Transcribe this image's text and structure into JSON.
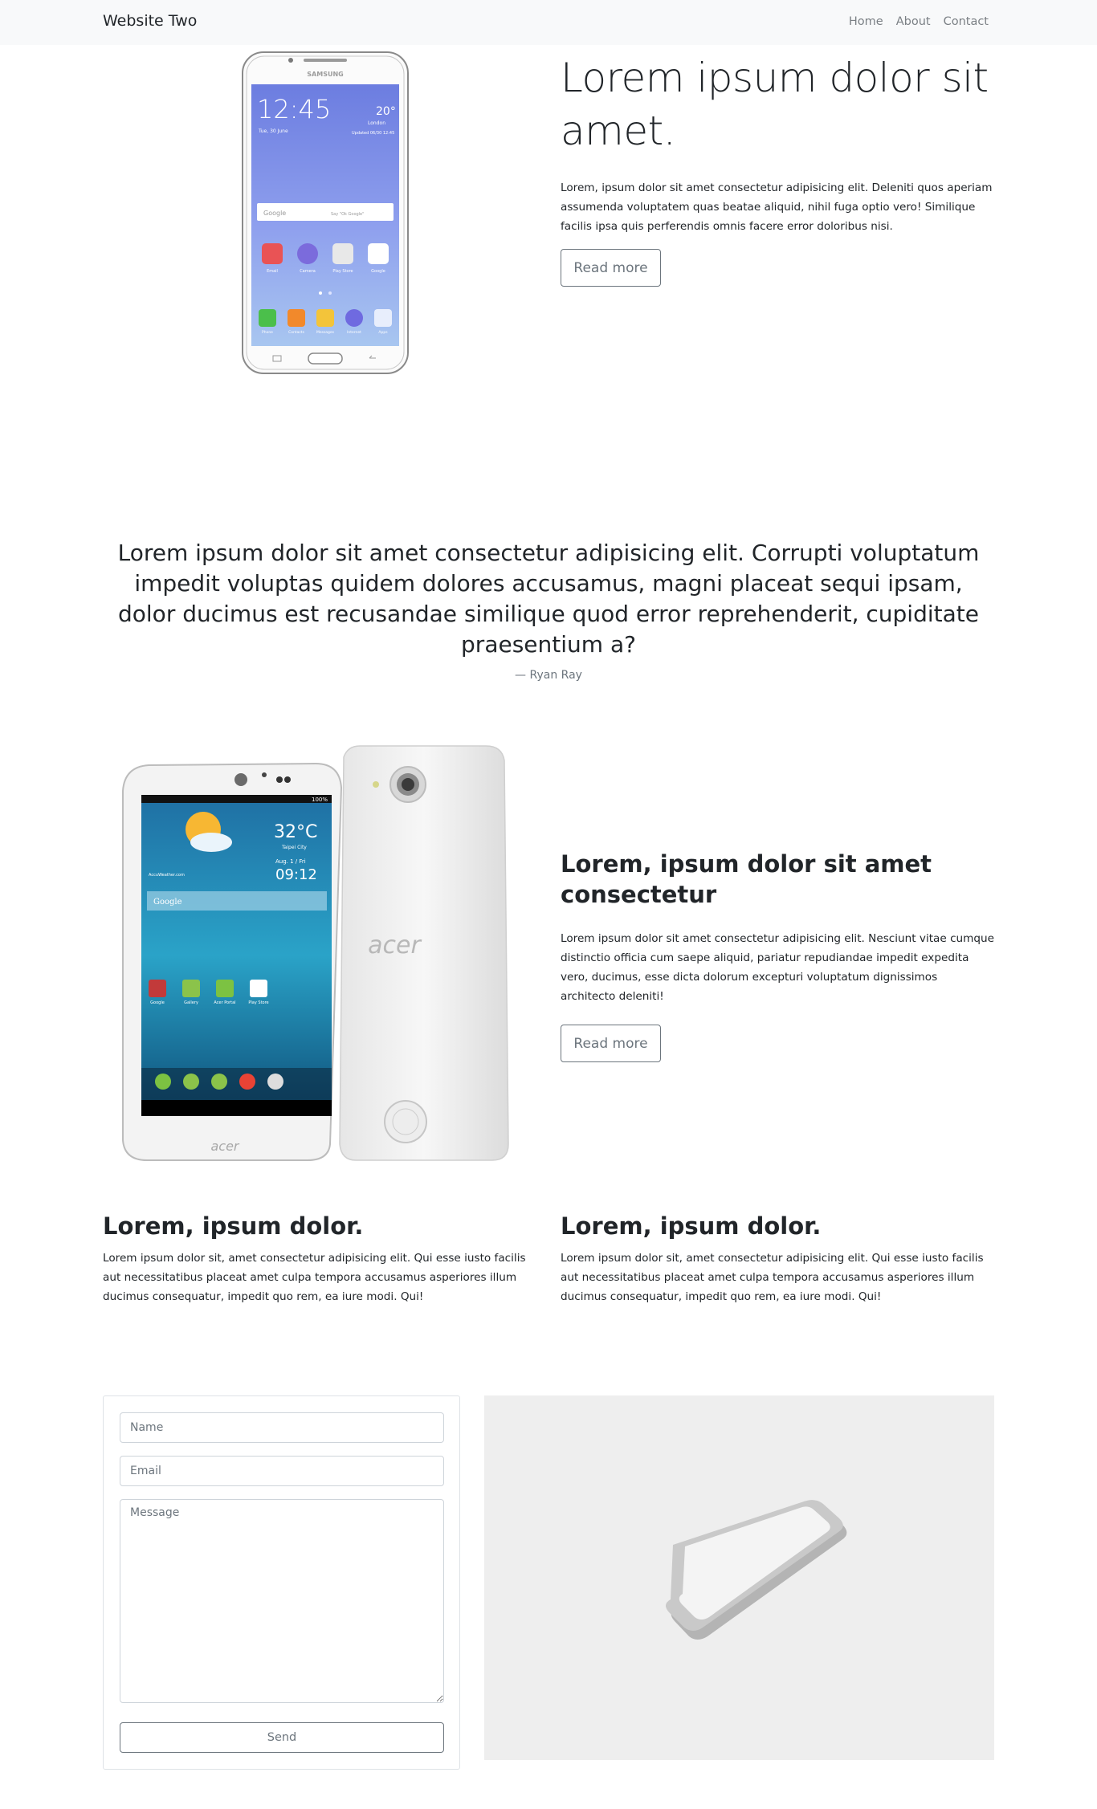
{
  "navbar": {
    "brand": "Website Two",
    "links": [
      "Home",
      "About",
      "Contact"
    ]
  },
  "hero": {
    "title": "Lorem ipsum dolor sit amet.",
    "text": "Lorem, ipsum dolor sit amet consectetur adipisicing elit. Deleniti quos aperiam assumenda voluptatem quas beatae aliquid, nihil fuga optio vero! Similique facilis ipsa quis perferendis omnis facere error doloribus nisi.",
    "button": "Read more",
    "phone": {
      "brand": "SAMSUNG",
      "time": "12:45",
      "date": "Tue, 30 June",
      "temp": "20°",
      "city": "London",
      "updated": "Updated 06/30 12:45",
      "search": "Google",
      "search_hint": "Say \"Ok Google\"",
      "apps_row1": [
        "Email",
        "Camera",
        "Play Store",
        "Google"
      ],
      "apps_row2": [
        "Phone",
        "Contacts",
        "Messages",
        "Internet",
        "Apps"
      ]
    }
  },
  "quote": {
    "text": "Lorem ipsum dolor sit amet consectetur adipisicing elit. Corrupti voluptatum impedit voluptas quidem dolores accusamus, magni placeat sequi ipsam, dolor ducimus est recusandae similique quod error reprehenderit, cupiditate praesentium a?",
    "author": "— Ryan Ray"
  },
  "feature": {
    "title": "Lorem, ipsum dolor sit amet consectetur",
    "text": "Lorem ipsum dolor sit amet consectetur adipisicing elit. Nesciunt vitae cumque distinctio officia cum saepe aliquid, pariatur repudiandae impedit expedita vero, ducimus, esse dicta dolorum excepturi voluptatum dignissimos architecto deleniti!",
    "button": "Read more",
    "phone": {
      "battery": "100%",
      "temp": "32°C",
      "city": "Taipei City",
      "date": "Aug. 1 / Fri",
      "time": "09:12",
      "weather_source": "AccuWeather.com",
      "search": "Google",
      "apps": [
        "Google",
        "Gallery",
        "Acer Portal",
        "Play Store"
      ],
      "back_logo": "acer",
      "front_logo": "acer"
    }
  },
  "columns": [
    {
      "title": "Lorem, ipsum dolor.",
      "text": "Lorem ipsum dolor sit, amet consectetur adipisicing elit. Qui esse iusto facilis aut necessitatibus placeat amet culpa tempora accusamus asperiores illum ducimus consequatur, impedit quo rem, ea iure modi. Qui!"
    },
    {
      "title": "Lorem, ipsum dolor.",
      "text": "Lorem ipsum dolor sit, amet consectetur adipisicing elit. Qui esse iusto facilis aut necessitatibus placeat amet culpa tempora accusamus asperiores illum ducimus consequatur, impedit quo rem, ea iure modi. Qui!"
    }
  ],
  "contact_form": {
    "name_placeholder": "Name",
    "email_placeholder": "Email",
    "message_placeholder": "Message",
    "send_label": "Send"
  },
  "colors": {
    "navbar_bg": "#f8f9fa",
    "text": "#212529",
    "muted": "#6c757d",
    "illustration_bg": "#eeeeee"
  }
}
